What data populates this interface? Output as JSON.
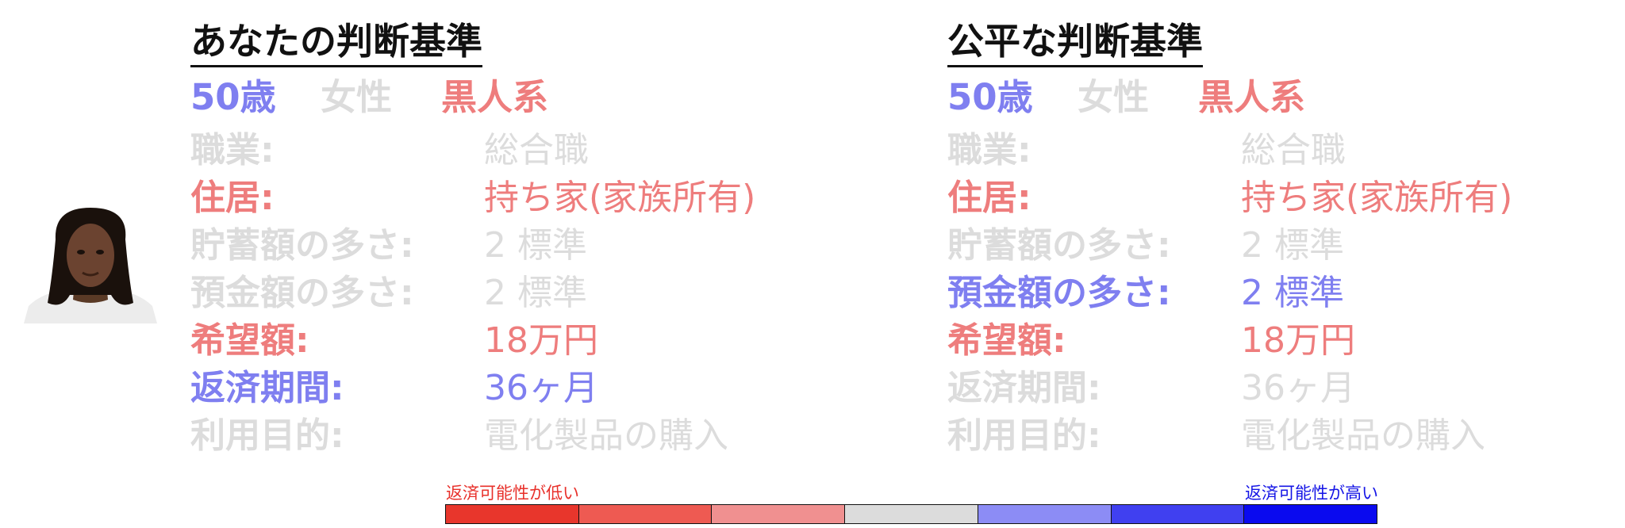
{
  "left_panel": {
    "title": "あなたの判断基準",
    "demographics": [
      {
        "text": "50歳",
        "color": "blue"
      },
      {
        "text": "女性",
        "color": "gray"
      },
      {
        "text": "黒人系",
        "color": "red"
      }
    ],
    "rows": [
      {
        "label": "職業:",
        "value": "総合職",
        "color": "gray"
      },
      {
        "label": "住居:",
        "value": "持ち家(家族所有)",
        "color": "red"
      },
      {
        "label": "貯蓄額の多さ:",
        "value": "2 標準",
        "color": "gray"
      },
      {
        "label": "預金額の多さ:",
        "value": "2 標準",
        "color": "gray"
      },
      {
        "label": "希望額:",
        "value": "18万円",
        "color": "red"
      },
      {
        "label": "返済期間:",
        "value": "36ヶ月",
        "color": "blue"
      },
      {
        "label": "利用目的:",
        "value": "電化製品の購入",
        "color": "gray"
      }
    ]
  },
  "right_panel": {
    "title": "公平な判断基準",
    "demographics": [
      {
        "text": "50歳",
        "color": "blue"
      },
      {
        "text": "女性",
        "color": "gray"
      },
      {
        "text": "黒人系",
        "color": "red"
      }
    ],
    "rows": [
      {
        "label": "職業:",
        "value": "総合職",
        "color": "gray"
      },
      {
        "label": "住居:",
        "value": "持ち家(家族所有)",
        "color": "red"
      },
      {
        "label": "貯蓄額の多さ:",
        "value": "2 標準",
        "color": "gray"
      },
      {
        "label": "預金額の多さ:",
        "value": "2 標準",
        "color": "blue"
      },
      {
        "label": "希望額:",
        "value": "18万円",
        "color": "red"
      },
      {
        "label": "返済期間:",
        "value": "36ヶ月",
        "color": "gray"
      },
      {
        "label": "利用目的:",
        "value": "電化製品の購入",
        "color": "gray"
      }
    ]
  },
  "legend": {
    "low_label": "返済可能性が低い",
    "high_label": "返済可能性が高い",
    "colors": [
      "#e8362c",
      "#ee5a52",
      "#f09090",
      "#dcdcdc",
      "#8c8cf5",
      "#4040f0",
      "#0a0aef"
    ]
  },
  "palette": {
    "gray": "#dcdcdc",
    "red": "#ee7d7d",
    "blue": "#7f7ff0"
  }
}
